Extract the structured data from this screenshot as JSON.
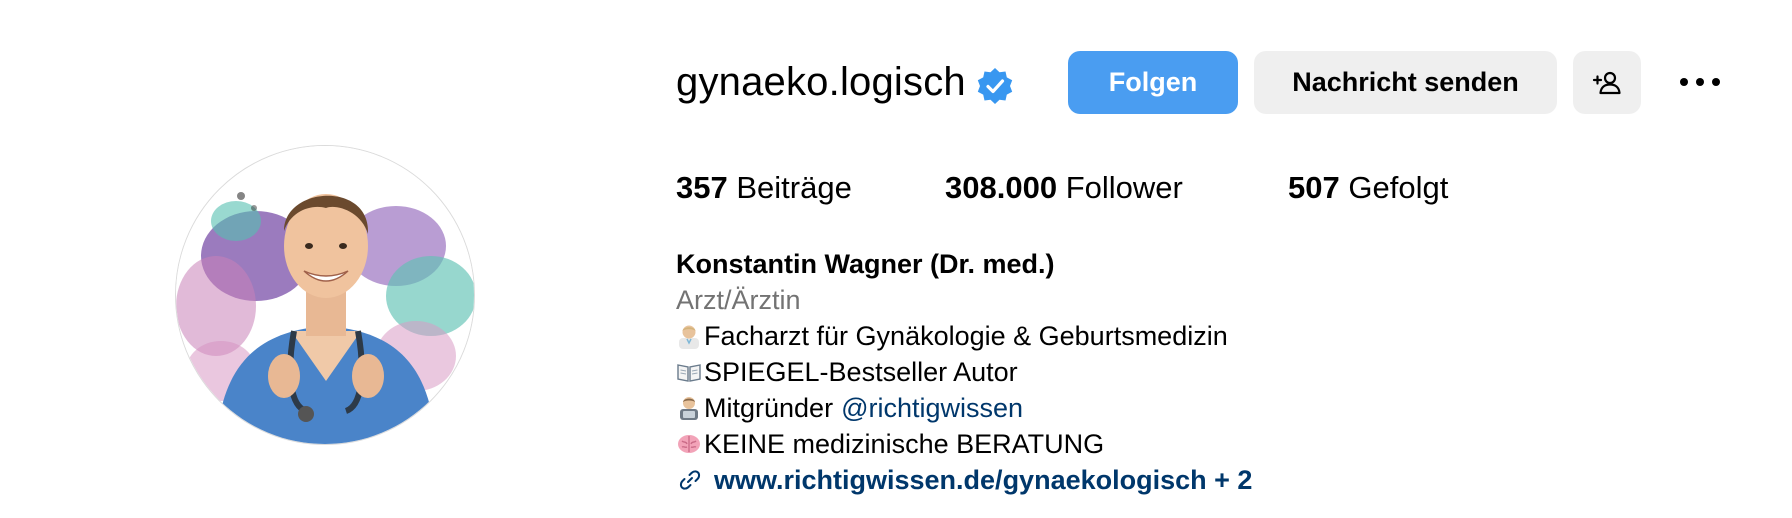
{
  "profile": {
    "username": "gynaeko.logisch",
    "verified": true,
    "avatar_alt": "profile-photo"
  },
  "actions": {
    "follow_label": "Folgen",
    "message_label": "Nachricht senden",
    "add_user_icon": "person-plus-icon",
    "more_icon": "more-dots-icon"
  },
  "stats": {
    "posts_count": "357",
    "posts_label": "Beiträge",
    "followers_count": "308.000",
    "followers_label": "Follower",
    "following_count": "507",
    "following_label": "Gefolgt"
  },
  "bio": {
    "name": "Konstantin Wagner (Dr. med.)",
    "category": "Arzt/Ärztin",
    "lines": {
      "line1": "Facharzt für Gynäkologie & Geburtsmedizin",
      "line2": "SPIEGEL-Bestseller Autor",
      "line3_prefix": "Mitgründer ",
      "line3_mention": "@richtigwissen",
      "line4": "KEINE medizinische BERATUNG"
    },
    "emoji_icons": [
      "doctor-emoji-icon",
      "open-book-emoji-icon",
      "technologist-emoji-icon",
      "brain-emoji-icon"
    ],
    "link_text": "www.richtigwissen.de/gynaekologisch + 2"
  },
  "colors": {
    "follow_button": "#4a9df1",
    "secondary_button": "#efefef",
    "verified_badge": "#3897f0",
    "link": "#00376b",
    "muted_text": "#737373"
  }
}
